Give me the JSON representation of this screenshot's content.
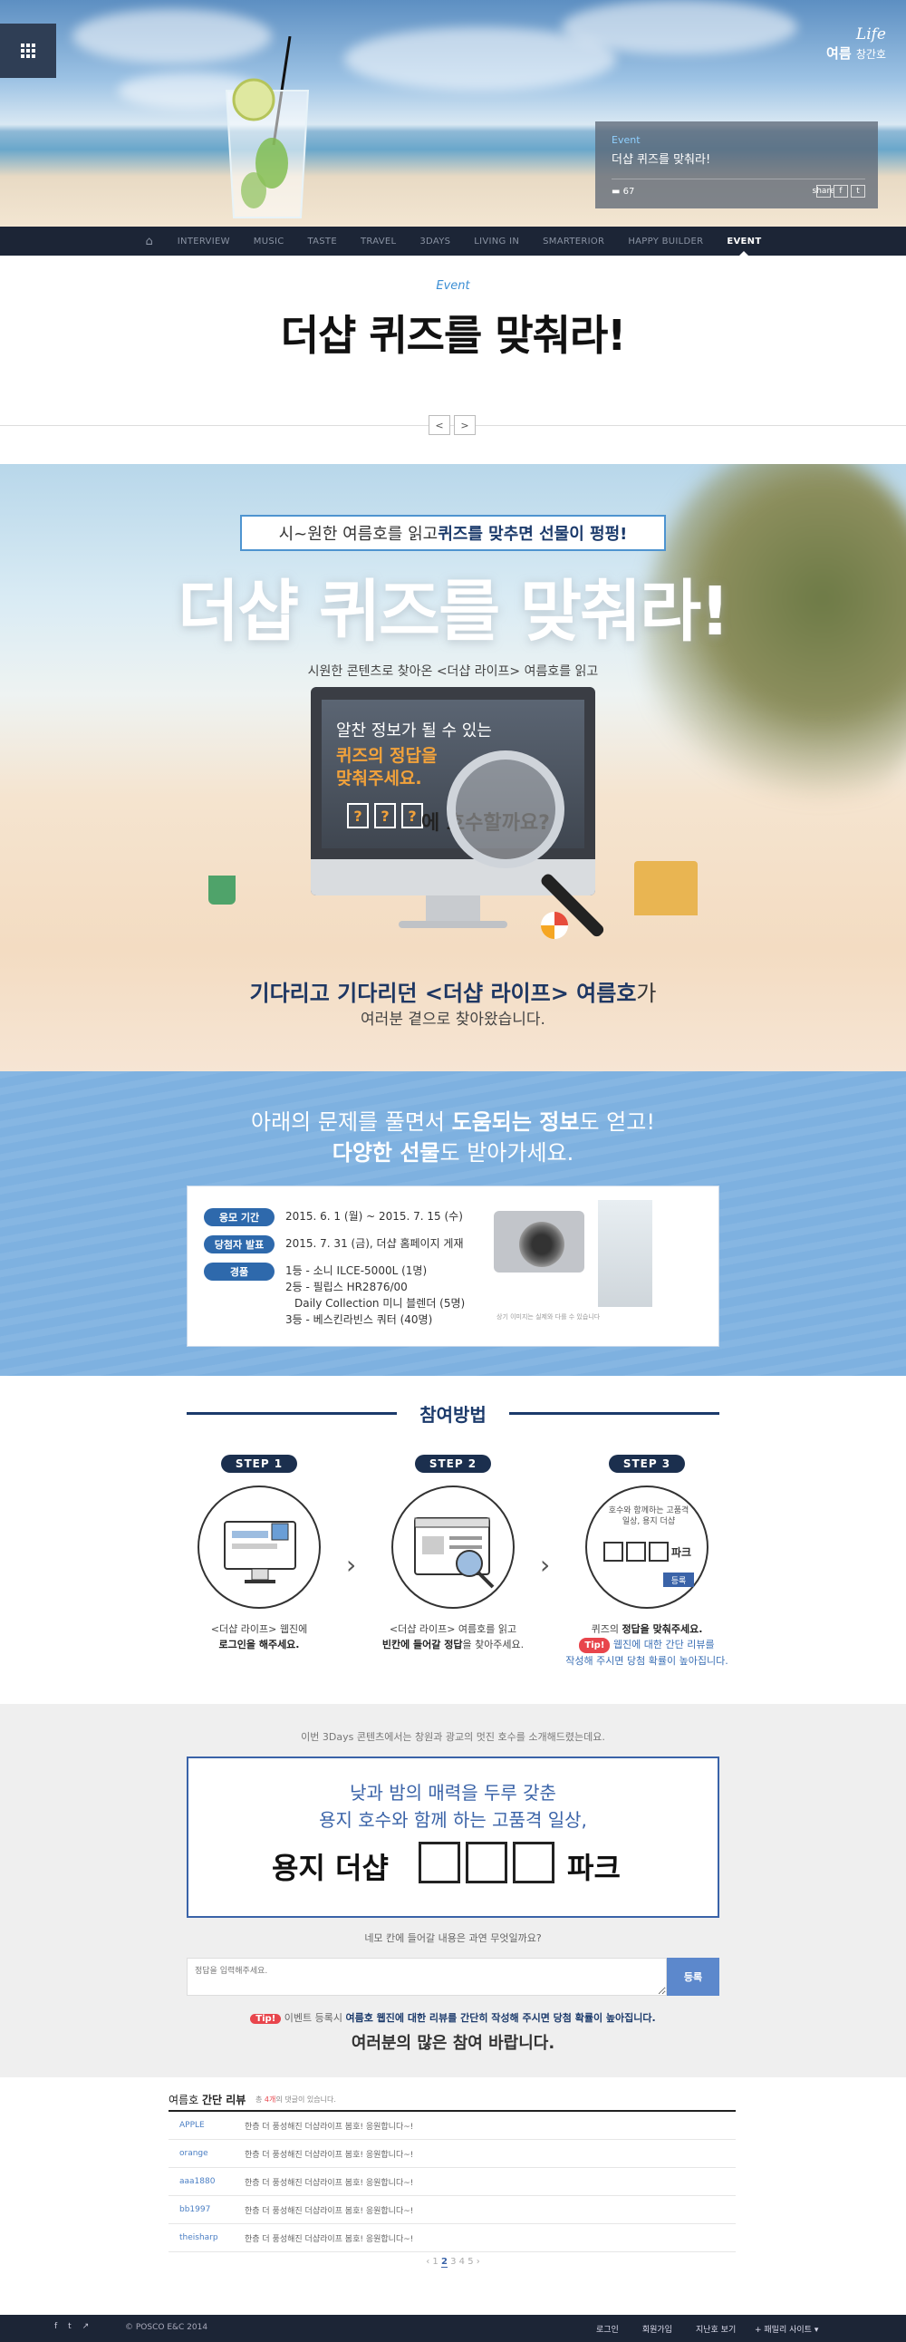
{
  "logo": {
    "line1": "Life",
    "line2": "여름",
    "line3": "창간호"
  },
  "feature": {
    "category": "Event",
    "title": "더샵 퀴즈를 맞춰라!",
    "comments": "67",
    "share_icons": [
      "share",
      "f",
      "t"
    ]
  },
  "nav": {
    "items": [
      "INTERVIEW",
      "MUSIC",
      "TASTE",
      "TRAVEL",
      "3DAYS",
      "LIVING IN",
      "SMARTERIOR",
      "HAPPY BUILDER",
      "EVENT"
    ],
    "active": "EVENT"
  },
  "page": {
    "label": "Event",
    "title": "더샵 퀴즈를 맞춰라!",
    "prev": "<",
    "next": ">"
  },
  "banner": {
    "ribbon_pre": "시~원한 여름호를 읽고 ",
    "ribbon_bold": "퀴즈를 맞추면 선물이 펑펑!",
    "title": "더샵 퀴즈를 맞춰라!",
    "sub": "시원한 콘텐츠로 찾아온 <더샵 라이프> 여름호를 읽고",
    "screen_l1": "알찬 정보가 될 수 있는",
    "screen_l2": "퀴즈의 정답을",
    "screen_l3": "맞춰주세요.",
    "screen_box": "?",
    "screen_q": "에 호수할까요?",
    "msg_bold": "기다리고 기다리던 <더샵 라이프> 여름호",
    "msg_ga": "가",
    "msg2": "여러분 곁으로 찾아왔습니다."
  },
  "info": {
    "head1_pre": "아래의 문제를 풀면서 ",
    "head1_bold": "도움되는 정보",
    "head1_post": "도 얻고!",
    "head2_bold": "다양한 선물",
    "head2_post": "도 받아가세요.",
    "rows": [
      {
        "tag": "응모 기간",
        "value": "2015. 6. 1 (월) ~ 2015. 7. 15 (수)"
      },
      {
        "tag": "당첨자 발표",
        "value": "2015. 7. 31 (금), 더샵 홈페이지 게재"
      },
      {
        "tag": "경품",
        "value": ""
      }
    ],
    "prizes": [
      "1등 - 소니 ILCE-5000L (1명)",
      "2등 - 필립스 HR2876/00",
      "Daily Collection 미니 블렌더 (5명)",
      "3등 - 베스킨라빈스 쿼터 (40명)"
    ],
    "prize_note": "상기 이미지는 실제와 다를 수 있습니다"
  },
  "how": {
    "title": "참여방법",
    "steps": [
      {
        "badge": "STEP 1",
        "d1": "<더샵 라이프> 웹진에",
        "d2": "로그인을 해주세요."
      },
      {
        "badge": "STEP 2",
        "d1": "<더샵 라이프> 여름호를 읽고",
        "d2b": "빈칸에 들어갈 정답",
        "d2": "을 찾아주세요."
      },
      {
        "badge": "STEP 3",
        "d1": "퀴즈의 ",
        "d1b": "정답을 맞춰주세요.",
        "tip": "Tip!",
        "d2": " 웹진에 대한 간단 리뷰를",
        "d3": "작성해 주시면 당첨 확률이 높아집니다."
      }
    ],
    "step3_circle_text": "호수와 함께하는 고품격 일상, 용지 더샵",
    "step3_circle_park": "파크",
    "step3_circle_btn": "등록"
  },
  "quiz": {
    "intro": "이번 3Days 콘텐츠에서는 창원과 광교의 멋진 호수를 소개해드렸는데요.",
    "line1": "낮과 밤의 매력을 두루 갖춘",
    "line2": "용지 호수와 함께 하는 고품격 일상,",
    "line3a": "용지 더샵",
    "line3b": "파크",
    "ask": "네모 칸에 들어갈 내용은 과연 무엇일까요?",
    "placeholder": "정답을 입력해주세요.",
    "submit": "등록",
    "tip": "Tip!",
    "tip_pre": " 이벤트 등록시 ",
    "tip_bold": "여름호 웹진에 대한 리뷰를 간단히 작성해 주시면 당첨 확률이 높아집니다.",
    "thanks": "여러분의 많은 참여 바랍니다."
  },
  "reviews": {
    "title_pre": "여름호 ",
    "title_bold": "간단 리뷰",
    "count_pre": "총 ",
    "count_num": "4개",
    "count_post": "의 댓글이 있습니다.",
    "rows": [
      {
        "user": "APPLE",
        "text": "한층 더 풍성해진 더샵라이프 봄호! 응원합니다~!"
      },
      {
        "user": "orange",
        "text": "한층 더 풍성해진 더샵라이프 봄호! 응원합니다~!"
      },
      {
        "user": "aaa1880",
        "text": "한층 더 풍성해진 더샵라이프 봄호! 응원합니다~!"
      },
      {
        "user": "bb1997",
        "text": "한층 더 풍성해진 더샵라이프 봄호! 응원합니다~!"
      },
      {
        "user": "theisharp",
        "text": "한층 더 풍성해진 더샵라이프 봄호! 응원합니다~!"
      }
    ],
    "pages": [
      "1",
      "2",
      "3",
      "4",
      "5"
    ],
    "current_page": "2"
  },
  "footer": {
    "copyright": "© POSCO E&C 2014",
    "links": [
      "로그인",
      "회원가입",
      "지난호 보기"
    ],
    "family": "패밀리 사이트"
  }
}
